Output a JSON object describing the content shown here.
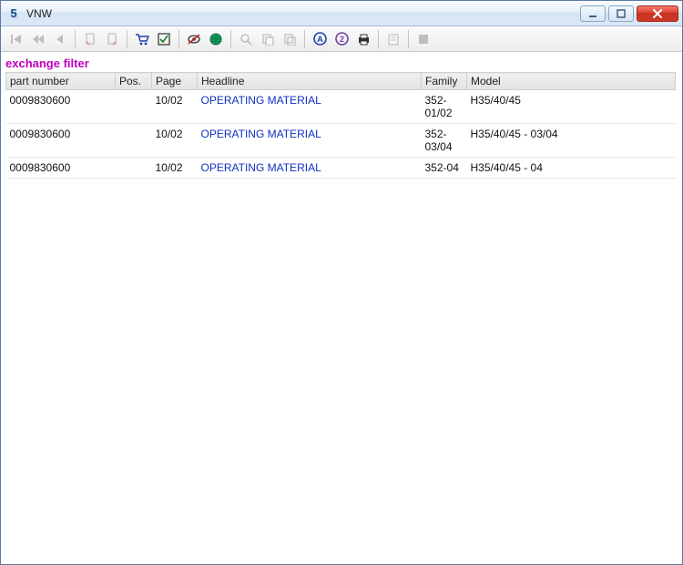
{
  "window": {
    "title": "VNW"
  },
  "filter_label": "exchange filter",
  "columns": {
    "part_number": "part number",
    "pos": "Pos.",
    "page": "Page",
    "headline": "Headline",
    "family": "Family",
    "model": "Model"
  },
  "rows": [
    {
      "part_number": "0009830600",
      "pos": "",
      "page": "10/02",
      "headline": "OPERATING MATERIAL",
      "family": "352-01/02",
      "model": "H35/40/45"
    },
    {
      "part_number": "0009830600",
      "pos": "",
      "page": "10/02",
      "headline": "OPERATING MATERIAL",
      "family": "352-03/04",
      "model": "H35/40/45 - 03/04"
    },
    {
      "part_number": "0009830600",
      "pos": "",
      "page": "10/02",
      "headline": "OPERATING MATERIAL",
      "family": "352-04",
      "model": "H35/40/45 - 04"
    }
  ],
  "toolbar_icons": [
    "first-icon",
    "rewind-icon",
    "back-icon",
    "|",
    "bookmark-prev-icon",
    "bookmark-next-icon",
    "|",
    "cart-icon",
    "checklist-icon",
    "|",
    "eye-off-icon",
    "globe-icon",
    "|",
    "zoom-icon",
    "copy-icon",
    "paste-icon",
    "|",
    "circle-a-icon",
    "circle-2-icon",
    "print-icon",
    "|",
    "note-icon",
    "|",
    "stop-icon"
  ],
  "toolbar_disabled": [
    "first-icon",
    "rewind-icon",
    "back-icon",
    "bookmark-prev-icon",
    "bookmark-next-icon",
    "zoom-icon",
    "copy-icon",
    "paste-icon",
    "note-icon",
    "stop-icon"
  ]
}
